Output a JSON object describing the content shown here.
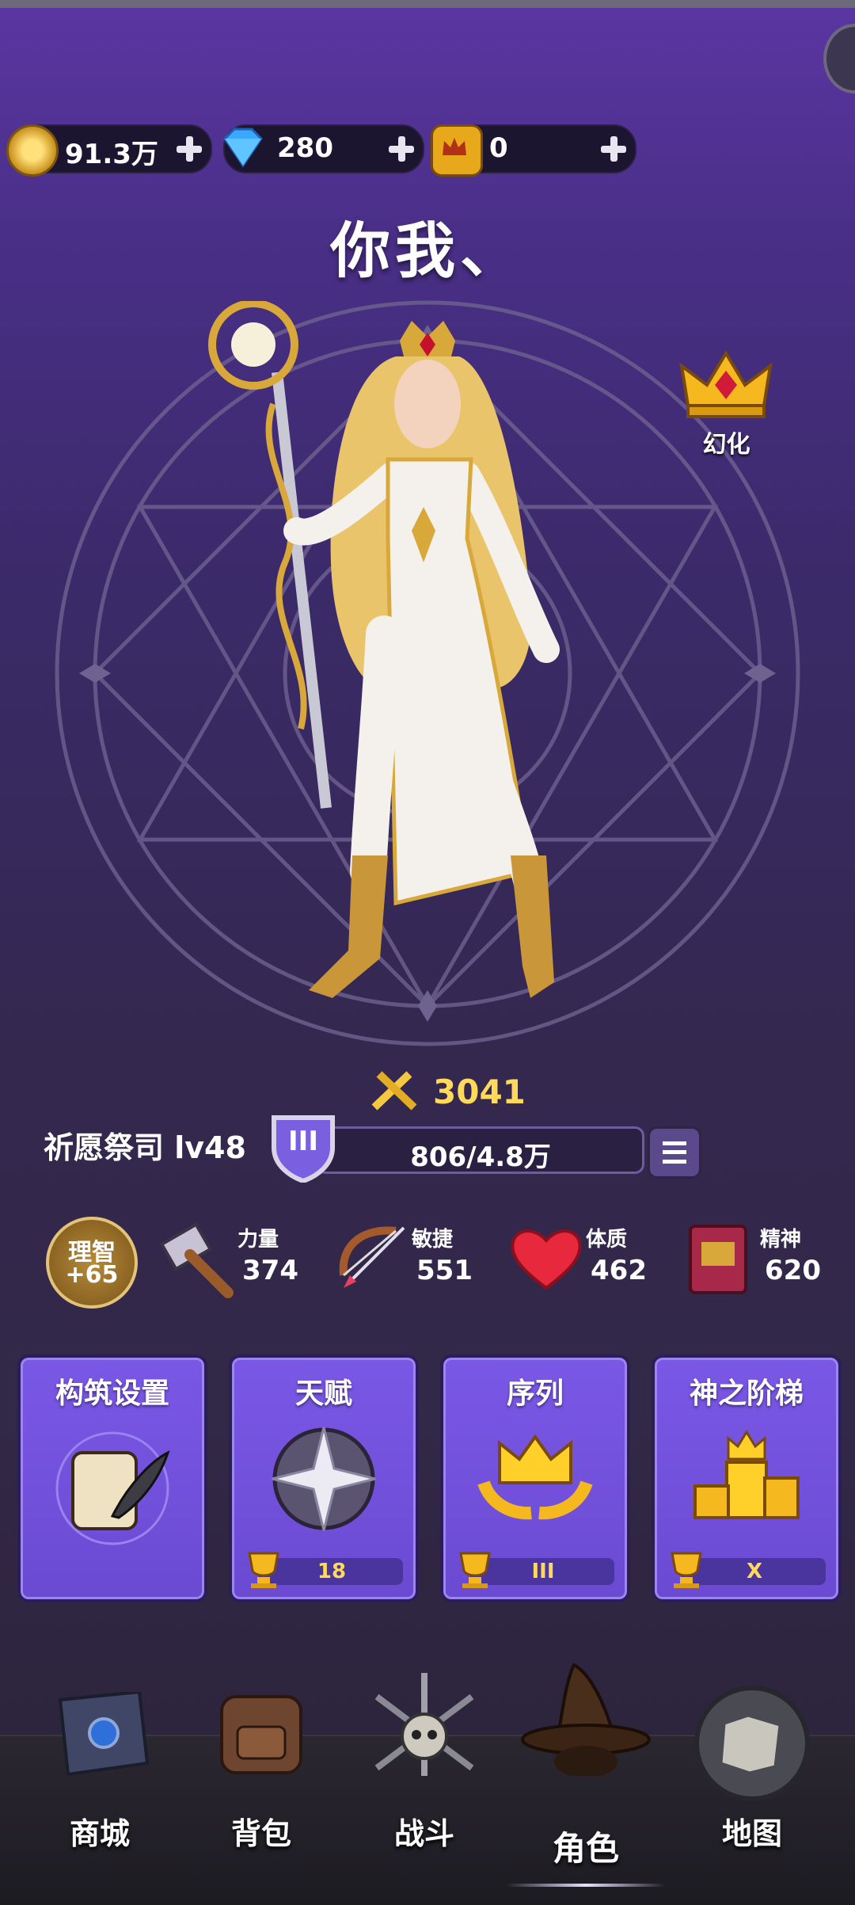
{
  "currencies": [
    {
      "name": "gold-coin",
      "value": "91.3万"
    },
    {
      "name": "diamond",
      "value": "280"
    },
    {
      "name": "crown-token",
      "value": "0"
    }
  ],
  "player_name": "你我、",
  "transform_label": "幻化",
  "power_score": "3041",
  "char_class_level": "祈愿祭司 lv48",
  "rank_badge": "III",
  "exp_text": "806/4.8万",
  "exp_fraction": 0.017,
  "intellect": {
    "label": "理智",
    "value": "+65"
  },
  "stats": [
    {
      "label": "力量",
      "value": "374",
      "icon": "hammer-icon"
    },
    {
      "label": "敏捷",
      "value": "551",
      "icon": "bow-icon"
    },
    {
      "label": "体质",
      "value": "462",
      "icon": "heart-icon"
    },
    {
      "label": "精神",
      "value": "620",
      "icon": "book-icon"
    }
  ],
  "cards": [
    {
      "title": "构筑设置",
      "badge": null
    },
    {
      "title": "天赋",
      "badge": "18"
    },
    {
      "title": "序列",
      "badge": "III"
    },
    {
      "title": "神之阶梯",
      "badge": "X"
    }
  ],
  "nav": [
    {
      "label": "商城",
      "icon": "shop-book-icon"
    },
    {
      "label": "背包",
      "icon": "backpack-icon"
    },
    {
      "label": "战斗",
      "icon": "battle-skull-icon"
    },
    {
      "label": "角色",
      "icon": "wizard-hat-icon",
      "active": true
    },
    {
      "label": "地图",
      "icon": "map-icon"
    }
  ],
  "colors": {
    "gold": "#ffd95a",
    "purple_card": "#7357e0",
    "bg_top": "#5b36a2"
  }
}
